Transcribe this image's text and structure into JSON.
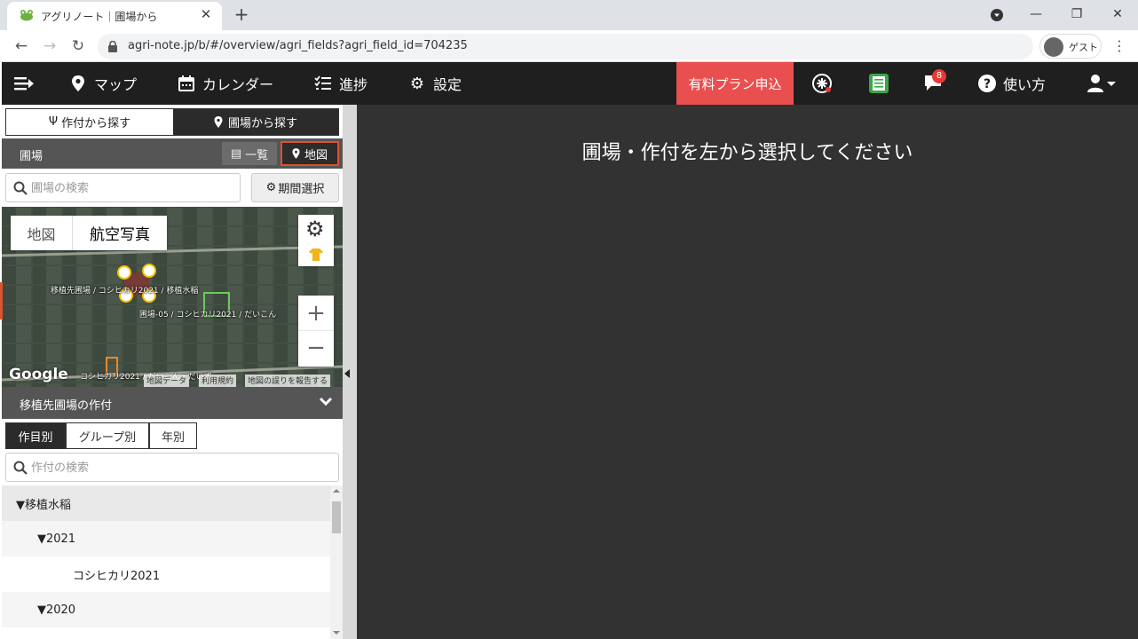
{
  "browser": {
    "tab_title": "アグリノート｜圃場から",
    "url": "agri-note.jp/b/#/overview/agri_fields?agri_field_id=704235",
    "profile_label": "ゲスト"
  },
  "header": {
    "map_label": "マップ",
    "calendar_label": "カレンダー",
    "progress_label": "進捗",
    "settings_label": "設定",
    "paid_plan_label": "有料プラン申込",
    "notification_count": "8",
    "help_label": "使い方"
  },
  "left": {
    "toggle_crop": "作付から探す",
    "toggle_field": "圃場から探す",
    "field_title": "圃場",
    "list_btn": "一覧",
    "map_btn": "地図",
    "search_placeholder": "圃場の検索",
    "period_btn": "期間選択",
    "map": {
      "type_map": "地図",
      "type_satellite": "航空写真",
      "label_1": "移植先圃場 / コシヒカリ2021 / 移植水稲",
      "label_2": "圃場-05 / コシヒカリ2021 / だいこん",
      "label_3": "コシヒカリ2021 / だいこん・だいず",
      "google": "Google",
      "attr_data": "地図データ",
      "attr_terms": "利用規約",
      "attr_report": "地図の誤りを報告する"
    },
    "crop_title": "移植先圃場の作付",
    "seg_crop": "作目別",
    "seg_group": "グループ別",
    "seg_year": "年別",
    "crop_search_placeholder": "作付の検索",
    "tree": [
      {
        "label": "▼移植水稲"
      },
      {
        "label": "▼2021"
      },
      {
        "label": "コシヒカリ2021"
      },
      {
        "label": "▼2020"
      }
    ]
  },
  "main": {
    "message": "圃場・作付を左から選択してください"
  },
  "colors": {
    "accent": "#ea4f4f",
    "dark": "#1f1f1f",
    "highlight_border": "#e0502e"
  }
}
